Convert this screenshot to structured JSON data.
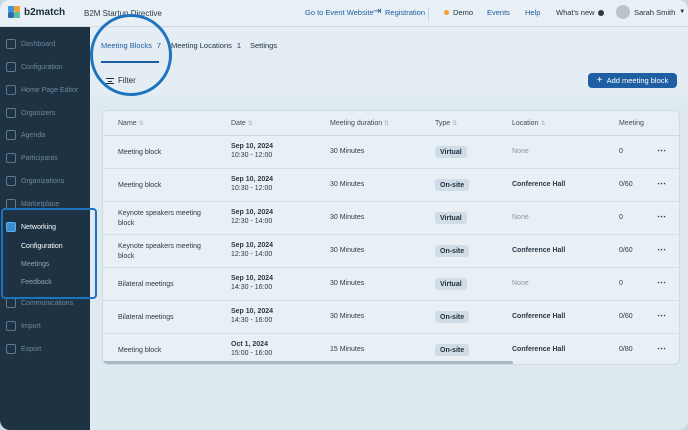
{
  "app": {
    "logo_text": "b2match",
    "event_name": "B2M Startup Directive"
  },
  "topnav": {
    "event_website": "Go to Event Website",
    "registration": "Registration",
    "demo": "Demo",
    "events": "Events",
    "help": "Help",
    "whats_new": "What's new",
    "user_name": "Sarah Smith"
  },
  "sidebar": {
    "items": [
      {
        "label": "Dashboard"
      },
      {
        "label": "Configuration"
      },
      {
        "label": "Home Page Editor"
      },
      {
        "label": "Organizers"
      },
      {
        "label": "Agenda"
      },
      {
        "label": "Participants"
      },
      {
        "label": "Organizations"
      },
      {
        "label": "Marketplace"
      },
      {
        "label": "Networking"
      },
      {
        "label": "Communications"
      },
      {
        "label": "Import"
      },
      {
        "label": "Export"
      }
    ],
    "subitems": [
      {
        "label": "Configuration"
      },
      {
        "label": "Meetings"
      },
      {
        "label": "Feedback"
      }
    ]
  },
  "tabs": [
    {
      "label": "Meeting Blocks",
      "count": "7"
    },
    {
      "label": "Meeting Locations",
      "count": "1"
    },
    {
      "label": "Settings",
      "count": ""
    }
  ],
  "filter_label": "Filter",
  "add_button": "Add meeting block",
  "table": {
    "columns": [
      "Name",
      "Date",
      "Meeting duration",
      "Type",
      "Location",
      "Meeting"
    ],
    "rows": [
      {
        "name": "Meeting block",
        "date": "Sep 10, 2024",
        "time": "10:30 - 12:00",
        "duration": "30 Minutes",
        "type": "Virtual",
        "location": "None",
        "meeting": "0"
      },
      {
        "name": "Meeting block",
        "date": "Sep 10, 2024",
        "time": "10:30 - 12:00",
        "duration": "30 Minutes",
        "type": "On-site",
        "location": "Conference Hall",
        "meeting": "0/60"
      },
      {
        "name": "Keynote speakers meeting block",
        "date": "Sep 10, 2024",
        "time": "12:30 - 14:00",
        "duration": "30 Minutes",
        "type": "Virtual",
        "location": "None",
        "meeting": "0"
      },
      {
        "name": "Keynote speakers meeting block",
        "date": "Sep 10, 2024",
        "time": "12:30 - 14:00",
        "duration": "30 Minutes",
        "type": "On-site",
        "location": "Conference Hall",
        "meeting": "0/60"
      },
      {
        "name": "Bilateral meetings",
        "date": "Sep 10, 2024",
        "time": "14:30 - 16:00",
        "duration": "30 Minutes",
        "type": "Virtual",
        "location": "None",
        "meeting": "0"
      },
      {
        "name": "Bilateral meetings",
        "date": "Sep 10, 2024",
        "time": "14:30 - 16:00",
        "duration": "30 Minutes",
        "type": "On-site",
        "location": "Conference Hall",
        "meeting": "0/60"
      },
      {
        "name": "Meeting block",
        "date": "Oct 1, 2024",
        "time": "15:00 - 16:00",
        "duration": "15 Minutes",
        "type": "On-site",
        "location": "Conference Hall",
        "meeting": "0/80"
      }
    ]
  },
  "colors": {
    "accent": "#1e5fa3",
    "sidebar_bg": "#1d3344",
    "highlight": "#1e73be",
    "demo_dot": "#f0a030"
  }
}
